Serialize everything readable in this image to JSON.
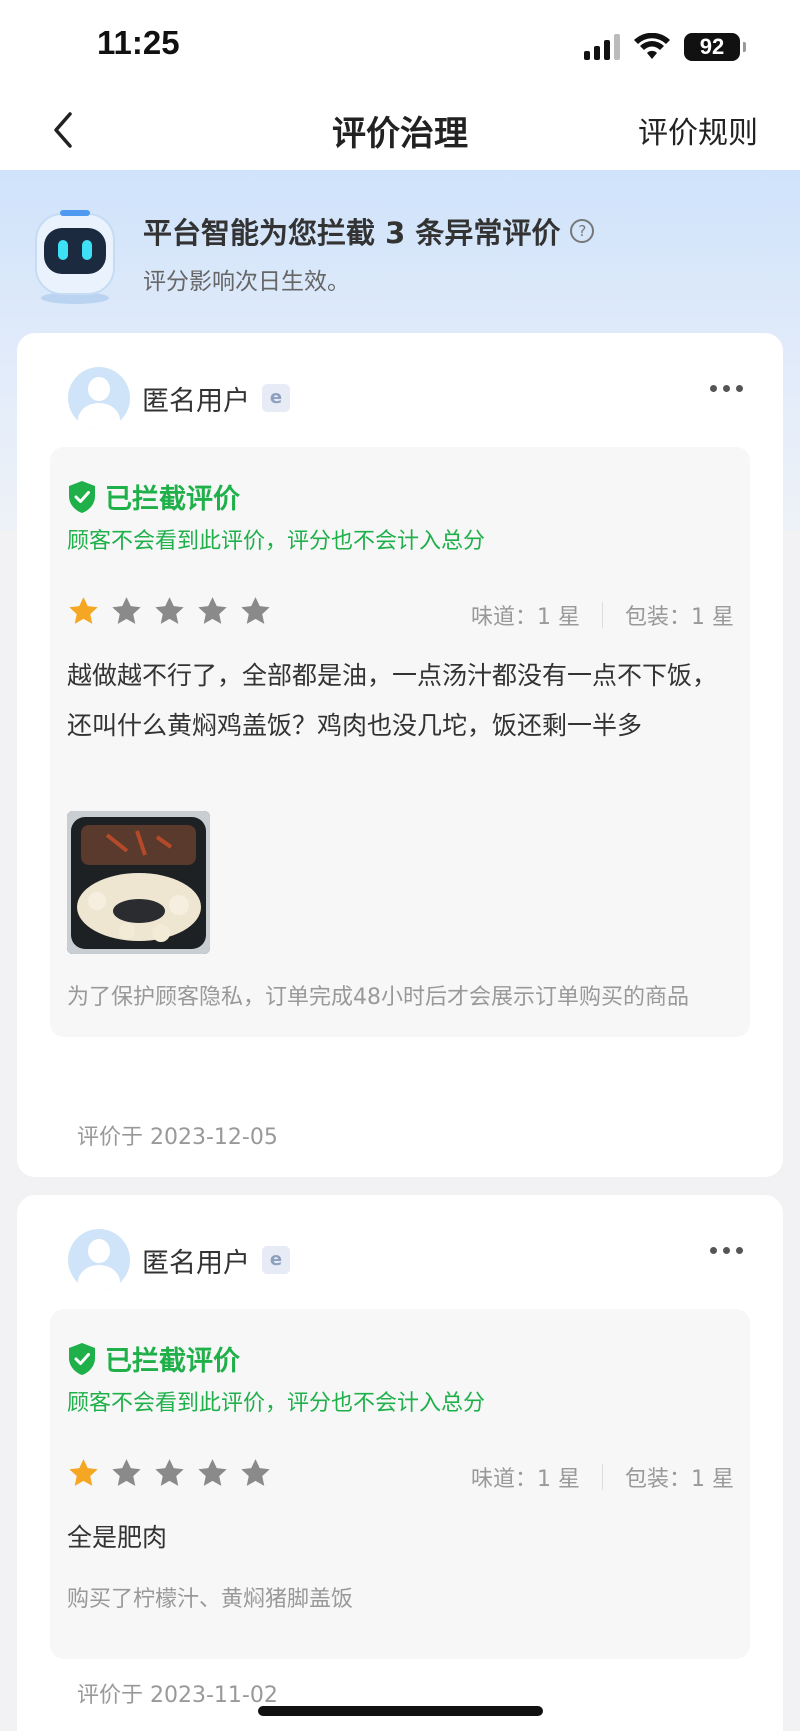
{
  "status_bar": {
    "time": "11:25",
    "battery": "92"
  },
  "nav": {
    "title": "评价治理",
    "rules_label": "评价规则"
  },
  "banner": {
    "title": "平台智能为您拦截 3 条异常评价",
    "subtitle": "评分影响次日生效。"
  },
  "reviews": [
    {
      "user_name": "匿名用户",
      "blocked_title": "已拦截评价",
      "blocked_desc": "顾客不会看到此评价，评分也不会计入总分",
      "rating": 1,
      "taste_score": "味道：1 星",
      "package_score": "包装：1 星",
      "text": "越做越不行了，全部都是油，一点汤汁都没有一点不下饭，还叫什么黄焖鸡盖饭？鸡肉也没几坨，饭还剩一半多",
      "footer_note": "为了保护顾客隐私，订单完成48小时后才会展示订单购买的商品",
      "date": "评价于 2023-12-05"
    },
    {
      "user_name": "匿名用户",
      "blocked_title": "已拦截评价",
      "blocked_desc": "顾客不会看到此评价，评分也不会计入总分",
      "rating": 1,
      "taste_score": "味道：1 星",
      "package_score": "包装：1 星",
      "text": "全是肥肉",
      "footer_note": "购买了柠檬汁、黄焖猪脚盖饭",
      "date": "评价于 2023-11-02"
    }
  ],
  "colors": {
    "accent_green": "#1fb04a",
    "star_orange": "#f5a623",
    "star_grey": "#8a8a8a"
  }
}
